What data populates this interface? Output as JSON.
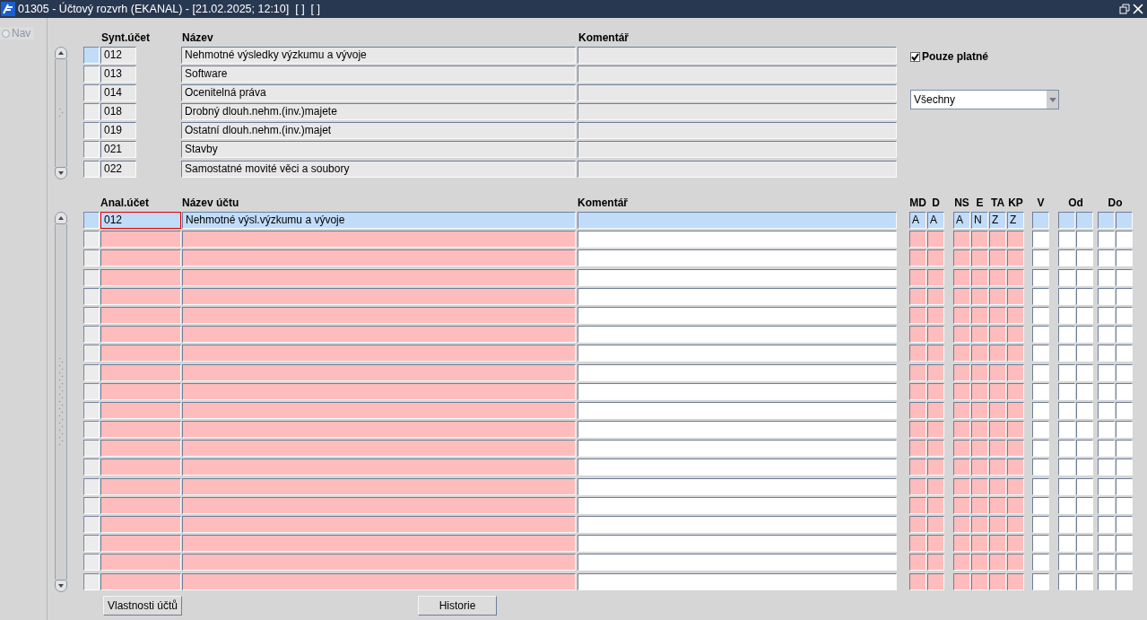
{
  "window": {
    "title": "01305 - Účtový rozvrh (EKANAL) - [21.02.2025; 12:10]  [ ]  [ ]"
  },
  "nav": {
    "label": "Nav",
    "selected": false
  },
  "synthetic_table": {
    "columns": [
      {
        "label": "Synt.účet"
      },
      {
        "label": "Název"
      },
      {
        "label": "Komentář"
      }
    ],
    "rows": [
      {
        "selected": true,
        "synt_ucet": "012",
        "nazev": "Nehmotné výsledky výzkumu a vývoje"
      },
      {
        "selected": false,
        "synt_ucet": "013",
        "nazev": "Software"
      },
      {
        "selected": false,
        "synt_ucet": "014",
        "nazev": "Ocenitelná práva"
      },
      {
        "selected": false,
        "synt_ucet": "018",
        "nazev": "Drobný dlouh.nehm.(inv.)majete"
      },
      {
        "selected": false,
        "synt_ucet": "019",
        "nazev": "Ostatní dlouh.nehm.(inv.)majet"
      },
      {
        "selected": false,
        "synt_ucet": "021",
        "nazev": "Stavby"
      },
      {
        "selected": false,
        "synt_ucet": "022",
        "nazev": "Samostatné movité věci a soubory"
      }
    ]
  },
  "filter": {
    "only_valid": {
      "label": "Pouze platné",
      "checked": true
    },
    "dropdown": {
      "value": "Všechny"
    }
  },
  "analytic_table": {
    "columns": [
      {
        "label": "Anal.účet",
        "required": true
      },
      {
        "label": "Název účtu",
        "required": true
      },
      {
        "label": "Komentář",
        "required": false
      },
      {
        "label": "MD",
        "required": true
      },
      {
        "label": "D",
        "required": true
      },
      {
        "label": "NS",
        "required": true
      },
      {
        "label": "E",
        "required": true
      },
      {
        "label": "TA",
        "required": true
      },
      {
        "label": "KP",
        "required": true
      },
      {
        "label": "V",
        "required": false
      },
      {
        "label": "Od",
        "required": false
      },
      {
        "label": "Do",
        "required": false
      }
    ],
    "rows": [
      {
        "selected": true,
        "focused": true,
        "anal_ucet": "012",
        "nazev_uctu": "Nehmotné výsl.výzkumu a vývoje",
        "md": "A",
        "d": "A",
        "ns": "A",
        "e": "N",
        "ta": "Z",
        "kp": "Z"
      },
      {
        "selected": false,
        "focused": false
      },
      {
        "selected": false,
        "focused": false
      },
      {
        "selected": false,
        "focused": false
      },
      {
        "selected": false,
        "focused": false
      },
      {
        "selected": false,
        "focused": false
      },
      {
        "selected": false,
        "focused": false
      },
      {
        "selected": false,
        "focused": false
      },
      {
        "selected": false,
        "focused": false
      },
      {
        "selected": false,
        "focused": false
      },
      {
        "selected": false,
        "focused": false
      },
      {
        "selected": false,
        "focused": false
      },
      {
        "selected": false,
        "focused": false
      },
      {
        "selected": false,
        "focused": false
      },
      {
        "selected": false,
        "focused": false
      },
      {
        "selected": false,
        "focused": false
      },
      {
        "selected": false,
        "focused": false
      },
      {
        "selected": false,
        "focused": false
      },
      {
        "selected": false,
        "focused": false
      },
      {
        "selected": false,
        "focused": false
      }
    ]
  },
  "buttons": [
    {
      "label": "Vlastnosti účtů"
    },
    {
      "label": "Historie"
    }
  ]
}
